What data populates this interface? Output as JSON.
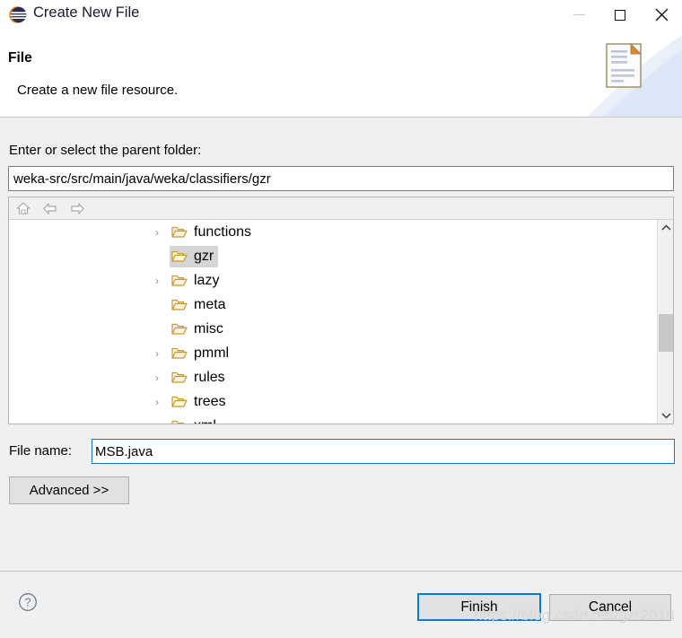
{
  "window": {
    "title": "Create New File",
    "app_icon": "eclipse-icon",
    "controls": {
      "minimize": "minimize-icon",
      "maximize": "maximize-icon",
      "close": "close-icon"
    }
  },
  "header": {
    "title": "File",
    "subtitle": "Create a new file resource.",
    "banner_icon": "new-file-document-icon"
  },
  "form": {
    "parent_folder_label": "Enter or select the parent folder:",
    "parent_folder_value": "weka-src/src/main/java/weka/classifiers/gzr",
    "file_name_label": "File name:",
    "file_name_value": "MSB.java",
    "advanced_label": "Advanced >>"
  },
  "tree_toolbar": {
    "home": "home-icon",
    "back": "back-arrow-icon",
    "forward": "forward-arrow-icon"
  },
  "tree": {
    "selected": "gzr",
    "items": [
      {
        "label": "functions",
        "expandable": true,
        "selected": false,
        "clipped": false
      },
      {
        "label": "gzr",
        "expandable": false,
        "selected": true,
        "clipped": false
      },
      {
        "label": "lazy",
        "expandable": true,
        "selected": false,
        "clipped": false
      },
      {
        "label": "meta",
        "expandable": false,
        "selected": false,
        "clipped": false
      },
      {
        "label": "misc",
        "expandable": false,
        "selected": false,
        "clipped": false
      },
      {
        "label": "pmml",
        "expandable": true,
        "selected": false,
        "clipped": false
      },
      {
        "label": "rules",
        "expandable": true,
        "selected": false,
        "clipped": false
      },
      {
        "label": "trees",
        "expandable": true,
        "selected": false,
        "clipped": false
      },
      {
        "label": "xml",
        "expandable": false,
        "selected": false,
        "clipped": true
      }
    ]
  },
  "scrollbar": {
    "up_arrow": "chevron-up-icon",
    "down_arrow": "chevron-down-icon"
  },
  "footer": {
    "help": "help-icon",
    "finish_label": "Finish",
    "cancel_label": "Cancel"
  },
  "watermark": {
    "text": "https://blog.csdn.net/gzr2018"
  },
  "colors": {
    "accent_blue": "#0a7ad6",
    "focus_border": "#1975c8",
    "panel_bg": "#f0f0f0",
    "folder_gold": "#d9a441",
    "selection_gray": "#d5d5d5"
  }
}
